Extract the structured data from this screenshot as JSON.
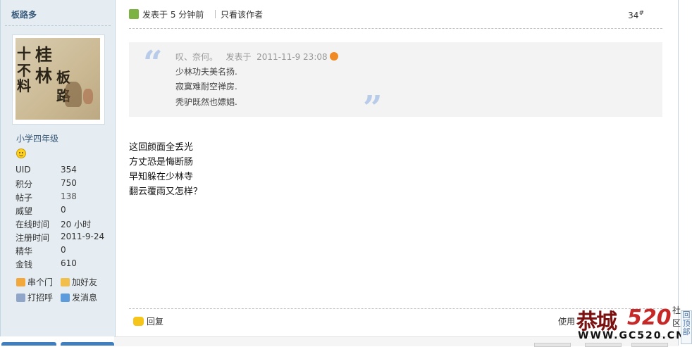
{
  "author": {
    "name": "板路多",
    "avatar_text": [
      "桂",
      "林",
      "板",
      "路",
      "十",
      "不",
      "料"
    ],
    "rank": "小学四年级",
    "stats": [
      {
        "label": "UID",
        "value": "354"
      },
      {
        "label": "积分",
        "value": "750"
      },
      {
        "label": "帖子",
        "value": "138"
      },
      {
        "label": "威望",
        "value": "0"
      },
      {
        "label": "在线时间",
        "value": "20 小时"
      },
      {
        "label": "注册时间",
        "value": "2011-9-24"
      },
      {
        "label": "精华",
        "value": "0"
      },
      {
        "label": "金钱",
        "value": "610"
      }
    ],
    "actions": {
      "visit": "串个门",
      "add_friend": "加好友",
      "poke": "打招呼",
      "message": "发消息"
    }
  },
  "post": {
    "posted": "发表于  5 分钟前",
    "only_author": "只看该作者",
    "floor": "34",
    "floor_mark": "#",
    "quote": {
      "author": "叹、奈何。",
      "posted_label": "发表于",
      "date": "2011-11-9 23:08",
      "lines": [
        "少林功夫美名扬.",
        "寂寞难耐空禅房.",
        "秃驴既然也嫖娼."
      ]
    },
    "body": [
      "这回颜面全丢光",
      "方丈恐是悔断肠",
      "早知躲在少林寺",
      "翻云覆雨又怎样？"
    ],
    "reply": "回复",
    "use_label": "使用"
  },
  "watermark": {
    "name": "恭城",
    "num": "520",
    "she": "社",
    "qu": "区",
    "url": "WWW.GC520.CN"
  },
  "back_to_top": [
    "回",
    "顶",
    "部"
  ]
}
